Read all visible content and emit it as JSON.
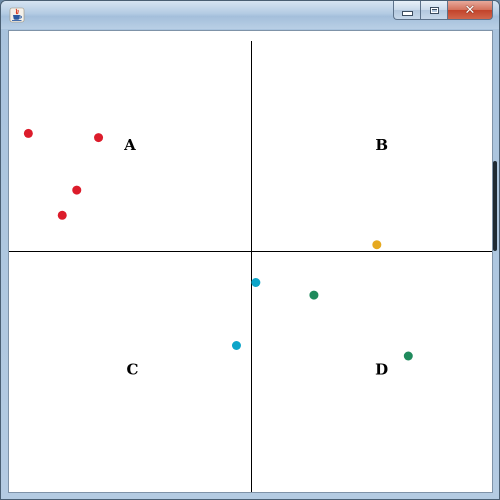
{
  "window": {
    "icon": "java-coffee-cup-icon",
    "controls": {
      "minimize": "minimize-icon",
      "maximize": "maximize-icon",
      "close": "close-icon",
      "close_glyph": "✕"
    }
  },
  "chart_data": {
    "type": "scatter",
    "xlim": [
      -1,
      1
    ],
    "ylim": [
      -1,
      1
    ],
    "axes_through_origin": true,
    "grid": false,
    "quadrant_labels": [
      {
        "text": "A",
        "x": -0.5,
        "y": 0.5
      },
      {
        "text": "B",
        "x": 0.54,
        "y": 0.5
      },
      {
        "text": "C",
        "x": -0.49,
        "y": -0.57
      },
      {
        "text": "D",
        "x": 0.54,
        "y": -0.57
      }
    ],
    "points": [
      {
        "x": -0.92,
        "y": 0.56,
        "color": "#dc1c2b"
      },
      {
        "x": -0.63,
        "y": 0.54,
        "color": "#dc1c2b"
      },
      {
        "x": -0.72,
        "y": 0.29,
        "color": "#dc1c2b"
      },
      {
        "x": -0.78,
        "y": 0.17,
        "color": "#dc1c2b"
      },
      {
        "x": 0.52,
        "y": 0.03,
        "color": "#e6a920"
      },
      {
        "x": 0.02,
        "y": -0.15,
        "color": "#0da5c9"
      },
      {
        "x": -0.06,
        "y": -0.45,
        "color": "#0da5c9"
      },
      {
        "x": 0.26,
        "y": -0.21,
        "color": "#1f8a5c"
      },
      {
        "x": 0.65,
        "y": -0.5,
        "color": "#1f8a5c"
      }
    ]
  }
}
